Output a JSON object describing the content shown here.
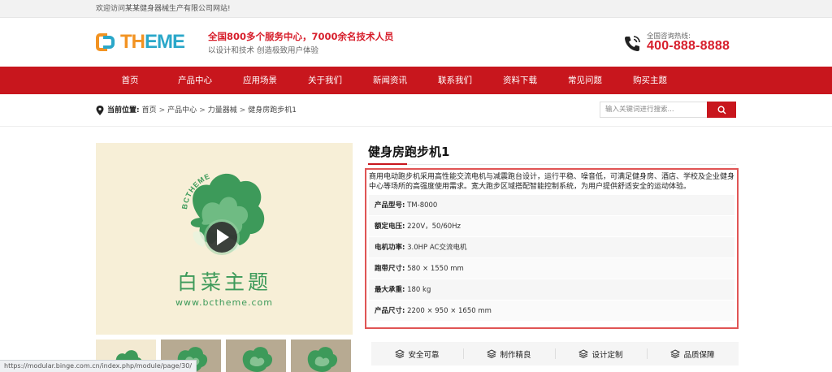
{
  "topbar": {
    "welcome": "欢迎访问某某健身器械生产有限公司网站!"
  },
  "header": {
    "logo_b": "BC",
    "logo_text_1": "TH",
    "logo_text_2": "EME",
    "slogan_main": "全国800多个服务中心，7000余名技术人员",
    "slogan_sub": "以设计和技术 创造极致用户体验",
    "hotline_label": "全国咨询热线:",
    "hotline_number": "400-888-8888"
  },
  "nav": {
    "items": [
      "首页",
      "产品中心",
      "应用场景",
      "关于我们",
      "新闻资讯",
      "联系我们",
      "资料下载",
      "常见问题",
      "购买主题"
    ]
  },
  "breadcrumb": {
    "label": "当前位置:",
    "items": [
      "首页",
      "产品中心",
      "力量器械",
      "健身房跑步机1"
    ],
    "separator": ">"
  },
  "search": {
    "placeholder": "输入关键词进行搜索..."
  },
  "gallery": {
    "watermark_arc": "BCTHEME",
    "watermark_cn": "白菜主题",
    "watermark_url": "www.bctheme.com"
  },
  "product": {
    "title": "健身房跑步机1",
    "description": "商用电动跑步机采用高性能交流电机与减震跑台设计，运行平稳、噪音低，可满足健身房、酒店、学校及企业健身中心等场所的高强度使用需求。宽大跑步区域搭配智能控制系统，为用户提供舒适安全的运动体验。",
    "specs": [
      {
        "label": "产品型号:",
        "value": "TM-8000"
      },
      {
        "label": "额定电压:",
        "value": "220V，50/60Hz"
      },
      {
        "label": "电机功率:",
        "value": "3.0HP AC交流电机"
      },
      {
        "label": "跑带尺寸:",
        "value": "580 × 1550 mm"
      },
      {
        "label": "最大承重:",
        "value": "180 kg"
      },
      {
        "label": "产品尺寸:",
        "value": "2200 × 950 × 1650 mm"
      }
    ],
    "features": [
      "安全可靠",
      "制作精良",
      "设计定制",
      "品质保障"
    ]
  },
  "statusbar": {
    "url": "https://modular.binge.com.cn/index.php/module/page/30/"
  },
  "colors": {
    "brand_red": "#c8161d",
    "logo_orange": "#f29322",
    "logo_blue": "#2aa7c9",
    "cabbage_green": "#3d9a5a"
  }
}
